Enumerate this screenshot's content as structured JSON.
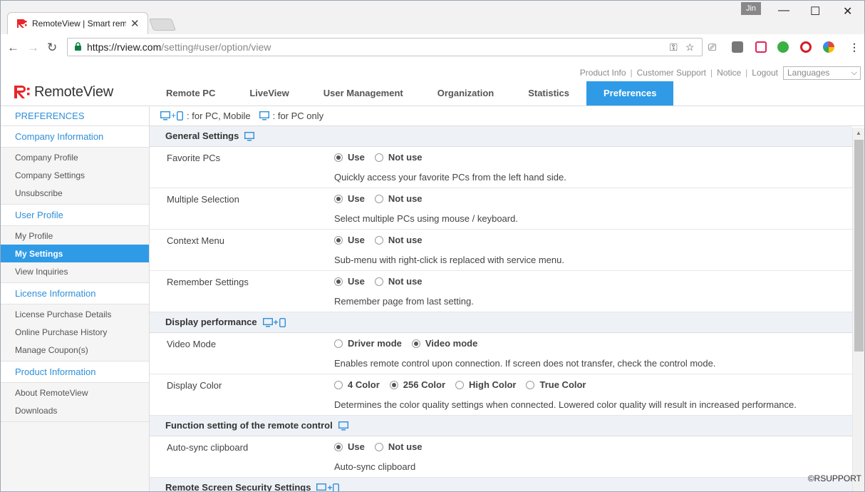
{
  "browser": {
    "tab_title": "RemoteView | Smart rem",
    "tab_close": "✕",
    "profile_name": "Jin",
    "url_host": "https://rview.com",
    "url_path": "/setting#user/option/view",
    "window_buttons": [
      "—",
      "☐",
      "✕"
    ]
  },
  "header": {
    "top_links": [
      "Product Info",
      "Customer Support",
      "Notice",
      "Logout"
    ],
    "languages_label": "Languages",
    "logo_text": "RemoteView",
    "nav": [
      "Remote PC",
      "LiveView",
      "User Management",
      "Organization",
      "Statistics",
      "Preferences"
    ],
    "active_nav": "Preferences"
  },
  "sidebar": {
    "title": "PREFERENCES",
    "sections": [
      {
        "label": "Company Information",
        "items": [
          "Company Profile",
          "Company Settings",
          "Unsubscribe"
        ]
      },
      {
        "label": "User Profile",
        "items": [
          "My Profile",
          "My Settings",
          "View Inquiries"
        ]
      },
      {
        "label": "License Information",
        "items": [
          "License Purchase Details",
          "Online Purchase History",
          "Manage Coupon(s)"
        ]
      },
      {
        "label": "Product Information",
        "items": [
          "About RemoteView",
          "Downloads"
        ]
      }
    ],
    "active_item": "My Settings"
  },
  "legend": {
    "pc_mobile_text": ": for PC, Mobile",
    "pc_only_text": ": for PC only",
    "plus": "+"
  },
  "sections": [
    {
      "title": "General Settings",
      "scope": "pc",
      "rows": [
        {
          "label": "Favorite PCs",
          "options": [
            "Use",
            "Not use"
          ],
          "selected": 0,
          "desc": "Quickly access your favorite PCs from the left hand side."
        },
        {
          "label": "Multiple Selection",
          "options": [
            "Use",
            "Not use"
          ],
          "selected": 0,
          "desc": "Select multiple PCs using mouse / keyboard."
        },
        {
          "label": "Context Menu",
          "options": [
            "Use",
            "Not use"
          ],
          "selected": 0,
          "desc": "Sub-menu with right-click is replaced with service menu."
        },
        {
          "label": "Remember Settings",
          "options": [
            "Use",
            "Not use"
          ],
          "selected": 0,
          "desc": "Remember page from last setting."
        }
      ]
    },
    {
      "title": "Display performance",
      "scope": "pc-mobile",
      "rows": [
        {
          "label": "Video Mode",
          "options": [
            "Driver mode",
            "Video mode"
          ],
          "selected": 1,
          "desc": "Enables remote control upon connection. If screen does not transfer, check the control mode."
        },
        {
          "label": "Display Color",
          "options": [
            "4 Color",
            "256 Color",
            "High Color",
            "True Color"
          ],
          "selected": 1,
          "desc": "Determines the color quality settings when connected. Lowered color quality will result in increased performance."
        }
      ]
    },
    {
      "title": "Function setting of the remote control",
      "scope": "pc",
      "rows": [
        {
          "label": "Auto-sync clipboard",
          "options": [
            "Use",
            "Not use"
          ],
          "selected": 0,
          "desc": "Auto-sync clipboard"
        }
      ]
    },
    {
      "title": "Remote Screen Security Settings",
      "scope": "pc-mobile",
      "rows": []
    }
  ],
  "footer": {
    "copyright": "©RSUPPORT"
  },
  "colors": {
    "accent": "#2f9be6",
    "link": "#2f8fd8",
    "logo_red": "#e8262b"
  }
}
